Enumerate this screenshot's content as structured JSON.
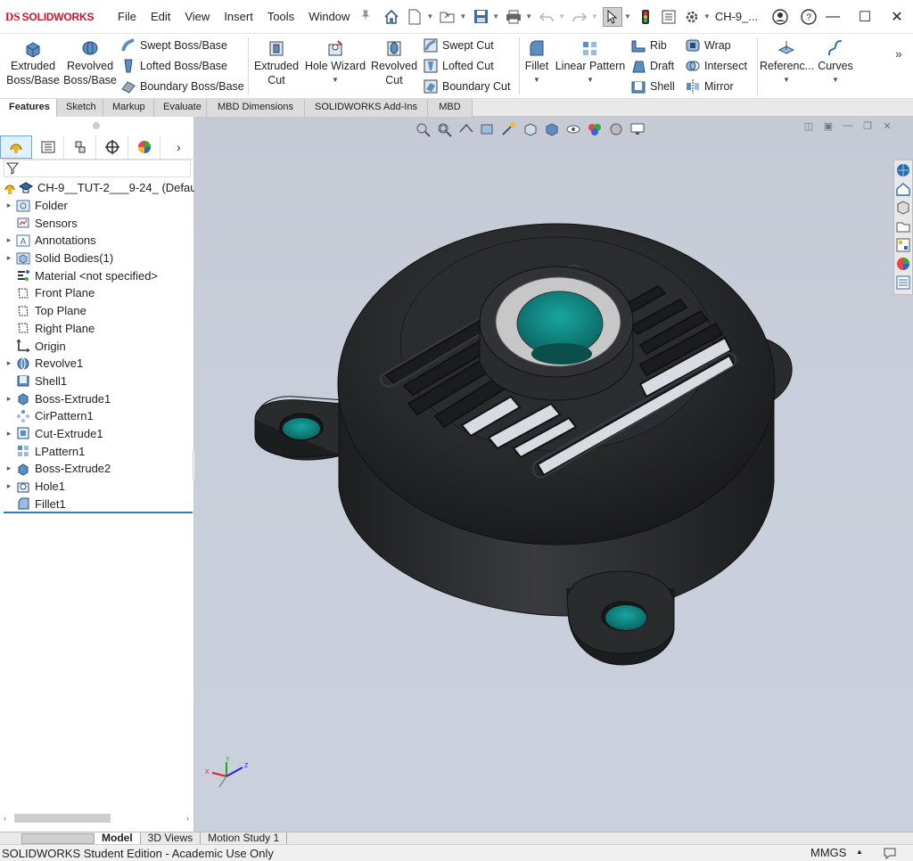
{
  "app": {
    "brand": "SOLIDWORKS",
    "logo_mark": "DS",
    "doc_short": "CH-9_..."
  },
  "menu": [
    "File",
    "Edit",
    "View",
    "Insert",
    "Tools",
    "Window"
  ],
  "ribbon": {
    "extruded_boss": "Extruded\nBoss/Base",
    "revolved_boss": "Revolved\nBoss/Base",
    "swept_boss": "Swept Boss/Base",
    "lofted_boss": "Lofted Boss/Base",
    "boundary_boss": "Boundary Boss/Base",
    "extruded_cut": "Extruded\nCut",
    "hole_wizard": "Hole Wizard",
    "revolved_cut": "Revolved\nCut",
    "swept_cut": "Swept Cut",
    "lofted_cut": "Lofted Cut",
    "boundary_cut": "Boundary Cut",
    "fillet": "Fillet",
    "linear_pattern": "Linear Pattern",
    "rib": "Rib",
    "draft": "Draft",
    "shell": "Shell",
    "wrap": "Wrap",
    "intersect": "Intersect",
    "mirror": "Mirror",
    "reference": "Referenc...",
    "curves": "Curves"
  },
  "tabs": [
    "Features",
    "Sketch",
    "Markup",
    "Evaluate",
    "MBD Dimensions",
    "SOLIDWORKS Add-Ins",
    "MBD"
  ],
  "tree": {
    "root": "CH-9__TUT-2___9-24_ (Defau",
    "items": [
      {
        "label": "Folder",
        "expand": true,
        "icon": "folder-icon"
      },
      {
        "label": "Sensors",
        "expand": false,
        "icon": "sensor-icon"
      },
      {
        "label": "Annotations",
        "expand": true,
        "icon": "annotations-icon"
      },
      {
        "label": "Solid Bodies(1)",
        "expand": true,
        "icon": "solid-bodies-icon"
      },
      {
        "label": "Material <not specified>",
        "expand": false,
        "icon": "material-icon"
      },
      {
        "label": "Front Plane",
        "expand": false,
        "icon": "plane-icon"
      },
      {
        "label": "Top Plane",
        "expand": false,
        "icon": "plane-icon"
      },
      {
        "label": "Right Plane",
        "expand": false,
        "icon": "plane-icon"
      },
      {
        "label": "Origin",
        "expand": false,
        "icon": "origin-icon"
      },
      {
        "label": "Revolve1",
        "expand": true,
        "icon": "revolve-icon"
      },
      {
        "label": "Shell1",
        "expand": false,
        "icon": "shell-icon"
      },
      {
        "label": "Boss-Extrude1",
        "expand": true,
        "icon": "extrude-icon"
      },
      {
        "label": "CirPattern1",
        "expand": false,
        "icon": "circular-pattern-icon"
      },
      {
        "label": "Cut-Extrude1",
        "expand": true,
        "icon": "cut-extrude-icon"
      },
      {
        "label": "LPattern1",
        "expand": false,
        "icon": "linear-pattern-icon"
      },
      {
        "label": "Boss-Extrude2",
        "expand": true,
        "icon": "extrude-icon"
      },
      {
        "label": "Hole1",
        "expand": true,
        "icon": "hole-icon"
      },
      {
        "label": "Fillet1",
        "expand": false,
        "icon": "fillet-icon"
      }
    ]
  },
  "bottom_tabs": [
    "Model",
    "3D Views",
    "Motion Study 1"
  ],
  "status": {
    "edition": "SOLIDWORKS Student Edition - Academic Use Only",
    "units": "MMGS"
  },
  "triad": {
    "x": "X",
    "y": "Y",
    "z": "Z"
  },
  "colors": {
    "brand": "#d1122a",
    "model": "#2a2b2d",
    "hole": "#0f8a86",
    "bearing": "#c7c7c7",
    "viewport": "#c8ced9"
  }
}
